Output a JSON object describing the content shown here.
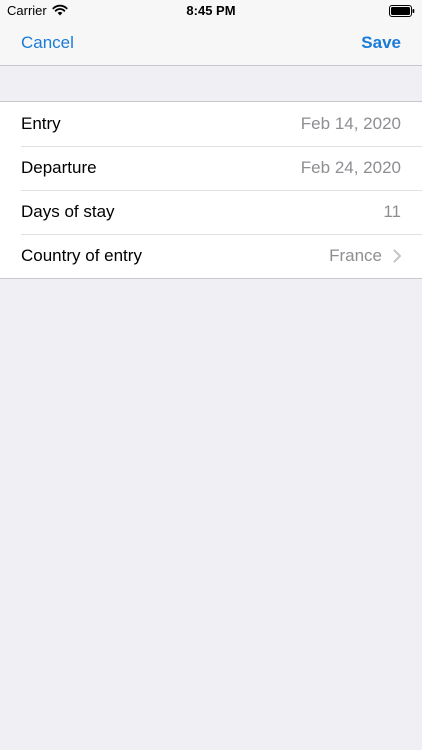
{
  "status_bar": {
    "carrier": "Carrier",
    "time": "8:45 PM",
    "wifi_icon": "wifi-icon",
    "battery_icon": "battery-icon"
  },
  "nav": {
    "cancel_label": "Cancel",
    "save_label": "Save",
    "accent_color": "#1a7bd7"
  },
  "form": {
    "rows": [
      {
        "label": "Entry",
        "value": "Feb 14, 2020"
      },
      {
        "label": "Departure",
        "value": "Feb 24, 2020"
      },
      {
        "label": "Days of stay",
        "value": "11"
      },
      {
        "label": "Country of entry",
        "value": "France",
        "icon": "chevron-right-icon"
      }
    ]
  }
}
